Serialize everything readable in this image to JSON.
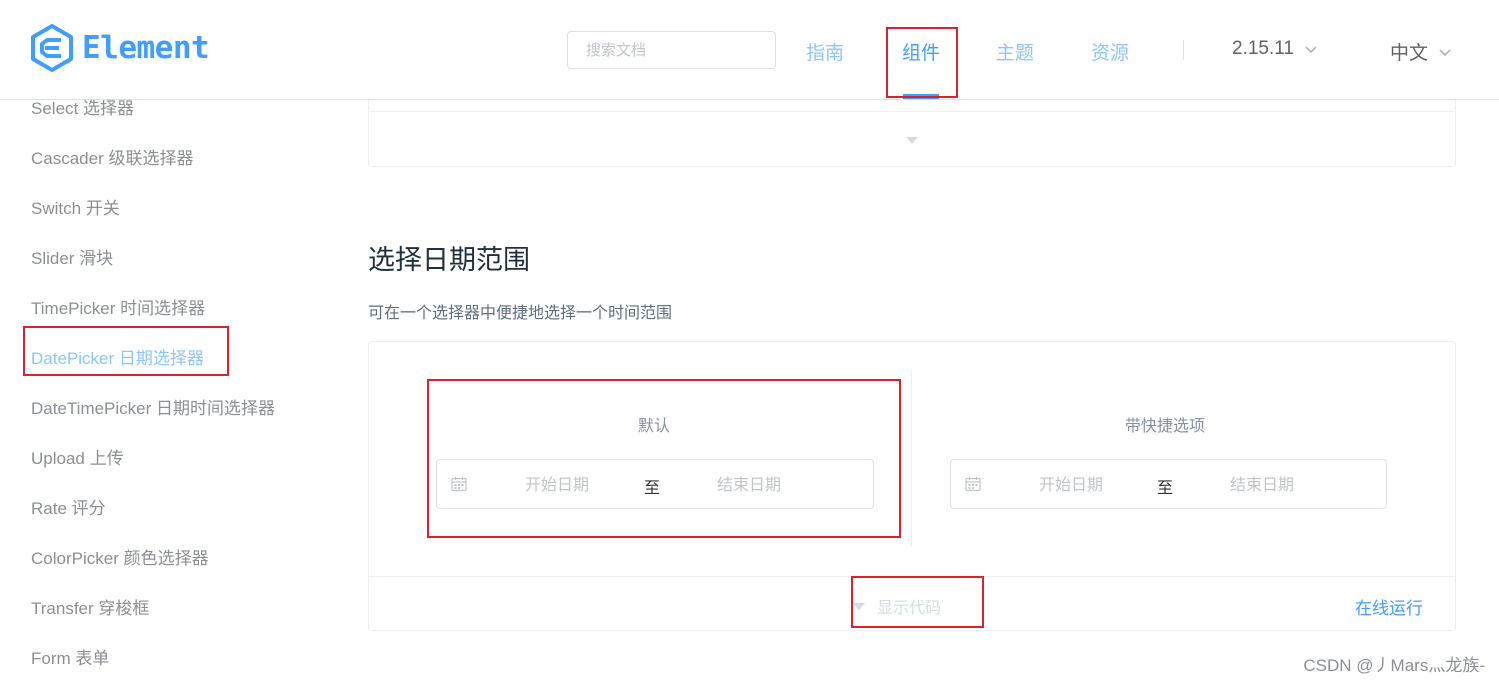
{
  "header": {
    "logo_text": "Element",
    "search_placeholder": "搜索文档",
    "nav": [
      {
        "label": "指南"
      },
      {
        "label": "组件"
      },
      {
        "label": "主题"
      },
      {
        "label": "资源"
      }
    ],
    "version": "2.15.11",
    "language": "中文",
    "accent_color": "#409eff"
  },
  "sidebar": {
    "items": [
      {
        "label": "Select 选择器"
      },
      {
        "label": "Cascader 级联选择器"
      },
      {
        "label": "Switch 开关"
      },
      {
        "label": "Slider 滑块"
      },
      {
        "label": "TimePicker 时间选择器"
      },
      {
        "label": "DatePicker 日期选择器"
      },
      {
        "label": "DateTimePicker 日期时间选择器"
      },
      {
        "label": "Upload 上传"
      },
      {
        "label": "Rate 评分"
      },
      {
        "label": "ColorPicker 颜色选择器"
      },
      {
        "label": "Transfer 穿梭框"
      },
      {
        "label": "Form 表单"
      }
    ]
  },
  "main": {
    "section_title": "选择日期范围",
    "section_desc": "可在一个选择器中便捷地选择一个时间范围",
    "blocks": [
      {
        "label": "默认",
        "start_placeholder": "开始日期",
        "separator": "至",
        "end_placeholder": "结束日期"
      },
      {
        "label": "带快捷选项",
        "start_placeholder": "开始日期",
        "separator": "至",
        "end_placeholder": "结束日期"
      }
    ],
    "show_code": "显示代码",
    "run_online": "在线运行"
  },
  "watermark": "CSDN @丿Mars灬龙族-"
}
